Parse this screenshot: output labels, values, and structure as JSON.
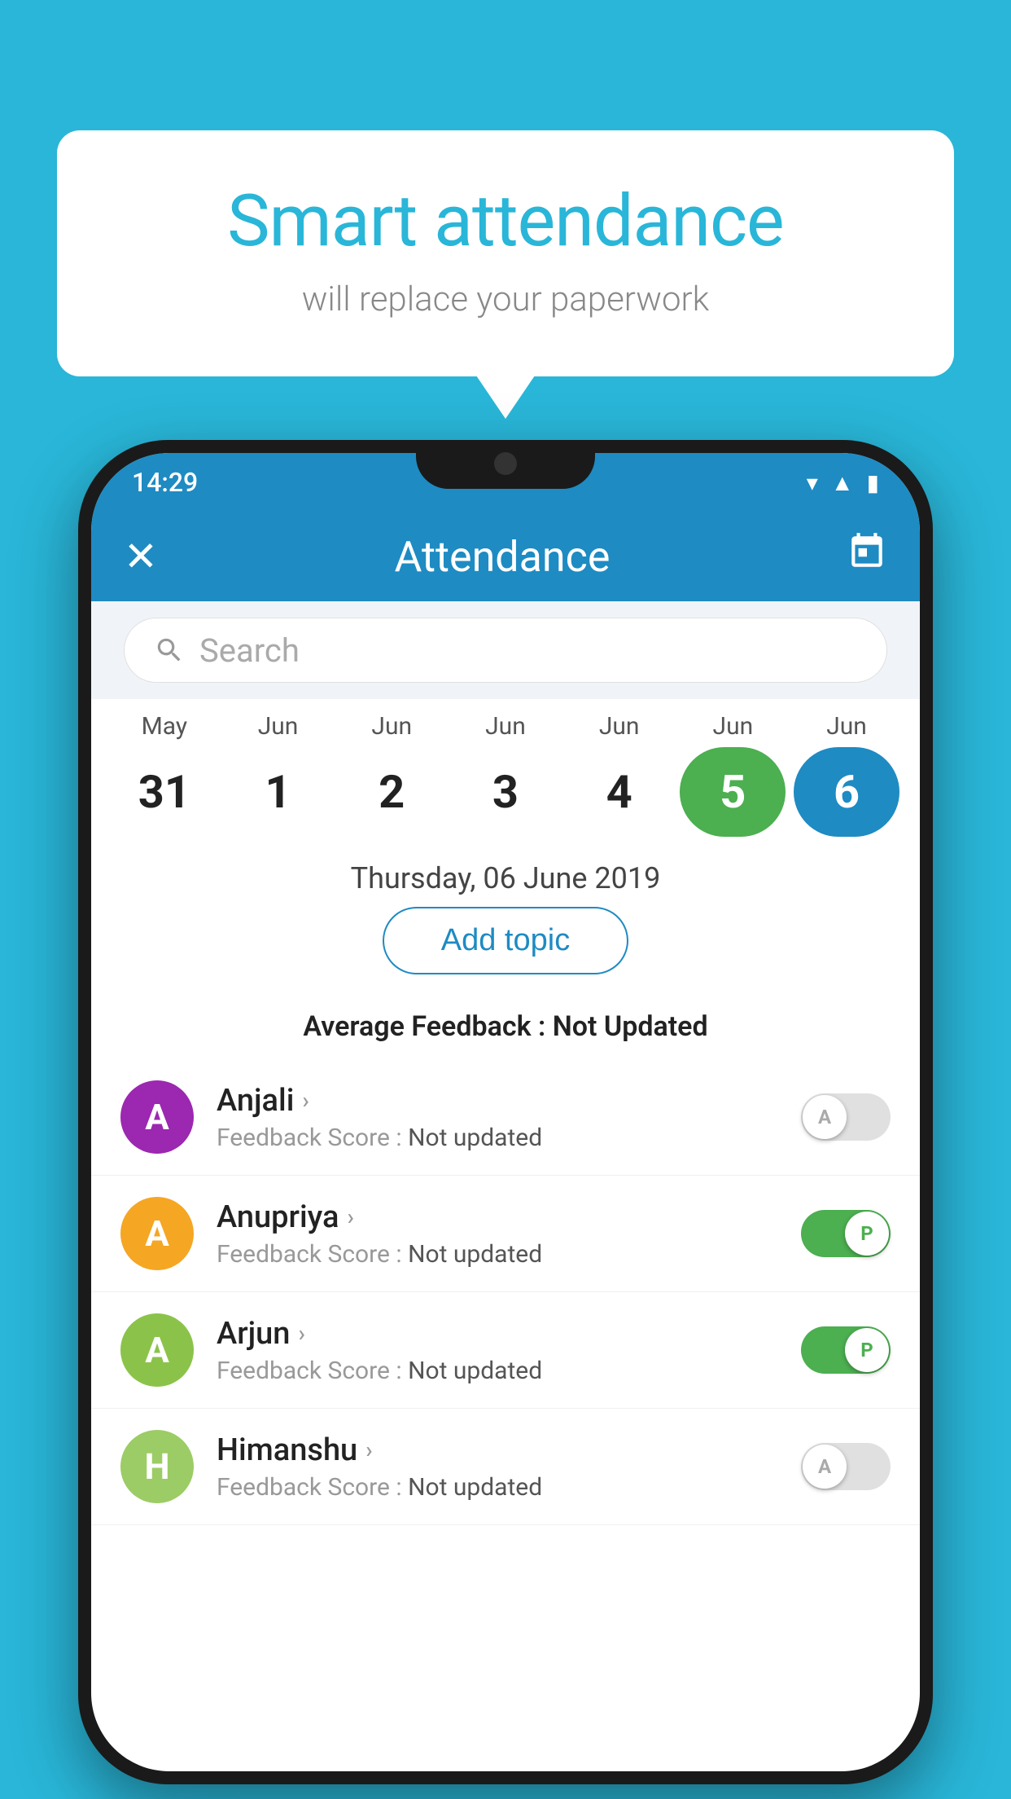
{
  "background_color": "#29b6d8",
  "speech_bubble": {
    "title": "Smart attendance",
    "subtitle": "will replace your paperwork"
  },
  "status_bar": {
    "time": "14:29",
    "icons": [
      "wifi",
      "signal",
      "battery"
    ]
  },
  "app_bar": {
    "close_icon": "✕",
    "title": "Attendance",
    "calendar_icon": "📅"
  },
  "search": {
    "placeholder": "Search"
  },
  "calendar": {
    "months": [
      "May",
      "Jun",
      "Jun",
      "Jun",
      "Jun",
      "Jun",
      "Jun"
    ],
    "days": [
      {
        "day": "31",
        "state": "normal"
      },
      {
        "day": "1",
        "state": "normal"
      },
      {
        "day": "2",
        "state": "normal"
      },
      {
        "day": "3",
        "state": "normal"
      },
      {
        "day": "4",
        "state": "normal"
      },
      {
        "day": "5",
        "state": "today"
      },
      {
        "day": "6",
        "state": "selected"
      }
    ]
  },
  "selected_date": "Thursday, 06 June 2019",
  "add_topic_label": "Add topic",
  "average_feedback_label": "Average Feedback : ",
  "average_feedback_value": "Not Updated",
  "students": [
    {
      "name": "Anjali",
      "avatar_letter": "A",
      "avatar_color": "#9c27b0",
      "feedback_label": "Feedback Score : ",
      "feedback_value": "Not updated",
      "toggle": "off",
      "toggle_label": "A"
    },
    {
      "name": "Anupriya",
      "avatar_letter": "A",
      "avatar_color": "#f5a623",
      "feedback_label": "Feedback Score : ",
      "feedback_value": "Not updated",
      "toggle": "on",
      "toggle_label": "P"
    },
    {
      "name": "Arjun",
      "avatar_letter": "A",
      "avatar_color": "#8bc34a",
      "feedback_label": "Feedback Score : ",
      "feedback_value": "Not updated",
      "toggle": "on",
      "toggle_label": "P"
    },
    {
      "name": "Himanshu",
      "avatar_letter": "H",
      "avatar_color": "#9ccc65",
      "feedback_label": "Feedback Score : ",
      "feedback_value": "Not updated",
      "toggle": "off",
      "toggle_label": "A"
    }
  ]
}
